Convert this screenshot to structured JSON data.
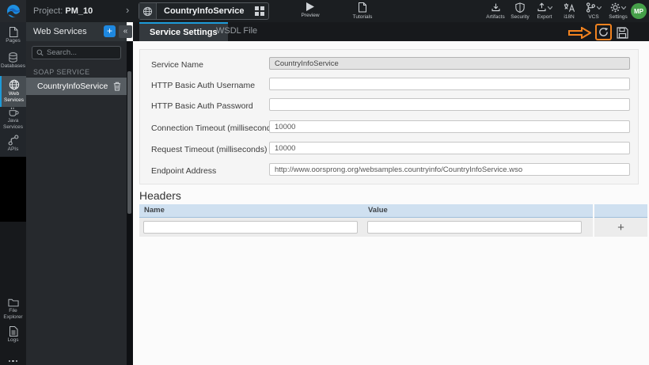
{
  "topbar": {
    "project_prefix": "Project:",
    "project_name": "PM_10",
    "service_name": "CountryInfoService",
    "preview_label": "Preview",
    "tutorials_label": "Tutorials",
    "actions": [
      {
        "label": "Artifacts",
        "icon": "download-icon"
      },
      {
        "label": "Security",
        "icon": "shield-icon"
      },
      {
        "label": "Export",
        "icon": "export-icon",
        "has_caret": true
      },
      {
        "label": "i18N",
        "icon": "translate-icon"
      },
      {
        "label": "VCS",
        "icon": "branch-icon",
        "has_caret": true
      },
      {
        "label": "Settings",
        "icon": "gear-icon",
        "has_caret": true
      }
    ],
    "avatar_initials": "MP"
  },
  "sidebar": {
    "items": [
      {
        "label": "Pages",
        "icon": "page-icon",
        "active": false
      },
      {
        "label": "Databases",
        "icon": "database-icon",
        "active": false
      },
      {
        "label": "Web Services",
        "icon": "globe-icon",
        "active": true
      },
      {
        "label": "Java Services",
        "icon": "coffee-icon",
        "active": false
      },
      {
        "label": "APIs",
        "icon": "api-icon",
        "active": false
      }
    ],
    "bottom_items": [
      {
        "label": "File Explorer",
        "icon": "folder-icon"
      },
      {
        "label": "Logs",
        "icon": "log-file-icon"
      }
    ],
    "more_label": "..."
  },
  "panel": {
    "title": "Web Services",
    "add_label": "+",
    "collapse_glyph": "«",
    "search_placeholder": "Search...",
    "section_label": "SOAP SERVICE",
    "items": [
      {
        "name": "CountryInfoService"
      }
    ]
  },
  "tabs": [
    {
      "label": "Service Settings",
      "active": true
    },
    {
      "label": "WSDL File",
      "active": false
    }
  ],
  "toolbar": {
    "reload_icon": "refresh-icon",
    "save_icon": "save-icon"
  },
  "form": {
    "fields": [
      {
        "label": "Service Name",
        "value": "CountryInfoService",
        "disabled": true
      },
      {
        "label": "HTTP Basic Auth Username",
        "value": ""
      },
      {
        "label": "HTTP Basic Auth Password",
        "value": ""
      },
      {
        "label": "Connection Timeout (milliseconds)",
        "value": "10000"
      },
      {
        "label": "Request Timeout (milliseconds)",
        "value": "10000"
      },
      {
        "label": "Endpoint Address",
        "value": "http://www.oorsprong.org/websamples.countryinfo/CountryInfoService.wso"
      }
    ]
  },
  "headers_section": {
    "title": "Headers",
    "columns": [
      "Name",
      "Value"
    ],
    "add_label": "+"
  },
  "colors": {
    "accent_blue": "#1d9bd9",
    "annotation_orange": "#f1821f",
    "avatar_green": "#46a049",
    "table_header_blue": "#cfe0f0",
    "topbar_dark": "#1b1e21"
  }
}
